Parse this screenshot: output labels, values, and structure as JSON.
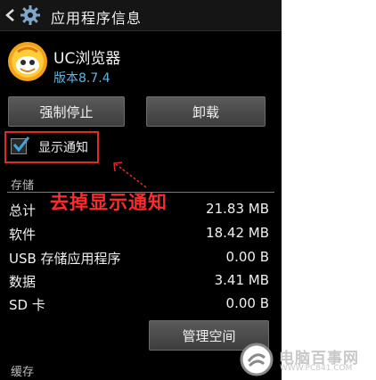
{
  "actionbar": {
    "title": "应用程序信息"
  },
  "app": {
    "name": "UC浏览器",
    "version": "版本8.7.4"
  },
  "buttons": {
    "force_stop": "强制停止",
    "uninstall": "卸载",
    "manage_space": "管理空间"
  },
  "notification": {
    "label": "显示通知",
    "checked": true
  },
  "annotation": {
    "text": "去掉显示通知"
  },
  "storage": {
    "header": "存储",
    "rows": [
      {
        "label": "总计",
        "value": "21.83 MB"
      },
      {
        "label": "软件",
        "value": "18.42 MB"
      },
      {
        "label": "USB 存储应用程序",
        "value": "0.00 B"
      },
      {
        "label": "数据",
        "value": "3.41 MB"
      },
      {
        "label": "SD 卡",
        "value": "0.00 B"
      }
    ]
  },
  "cache": {
    "header": "缓存"
  },
  "watermark": {
    "text": "电脑百事网",
    "url": "WWW.PC841.COM"
  },
  "colors": {
    "background": "#000000",
    "accent": "#5fb4e0",
    "annotation": "#ff2a2a",
    "highlight_box": "#e32626"
  }
}
